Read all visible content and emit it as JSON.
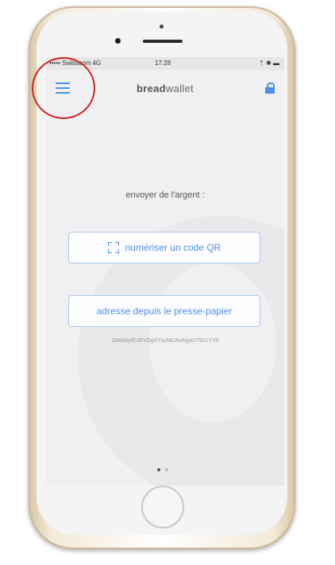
{
  "status_bar": {
    "carrier": "••••• Swisscom 4G",
    "time": "17:28",
    "right": "⇡ ✱ ▬"
  },
  "nav": {
    "brand_bold": "bread",
    "brand_light": "wallet",
    "menu_icon": "hamburger-icon",
    "lock_icon": "lock-icon"
  },
  "main": {
    "title": "envoyer de l'argent :",
    "scan_button": "numériser un code QR",
    "clipboard_button": "adresse depuis le presse-papier",
    "address": "1Mddoj4ExEVDgXYzuNCAvmgaV7Sc1YVh"
  },
  "pager": {
    "current": 1,
    "total": 2
  },
  "colors": {
    "accent": "#4c8fe6",
    "highlight": "#d0261b"
  }
}
